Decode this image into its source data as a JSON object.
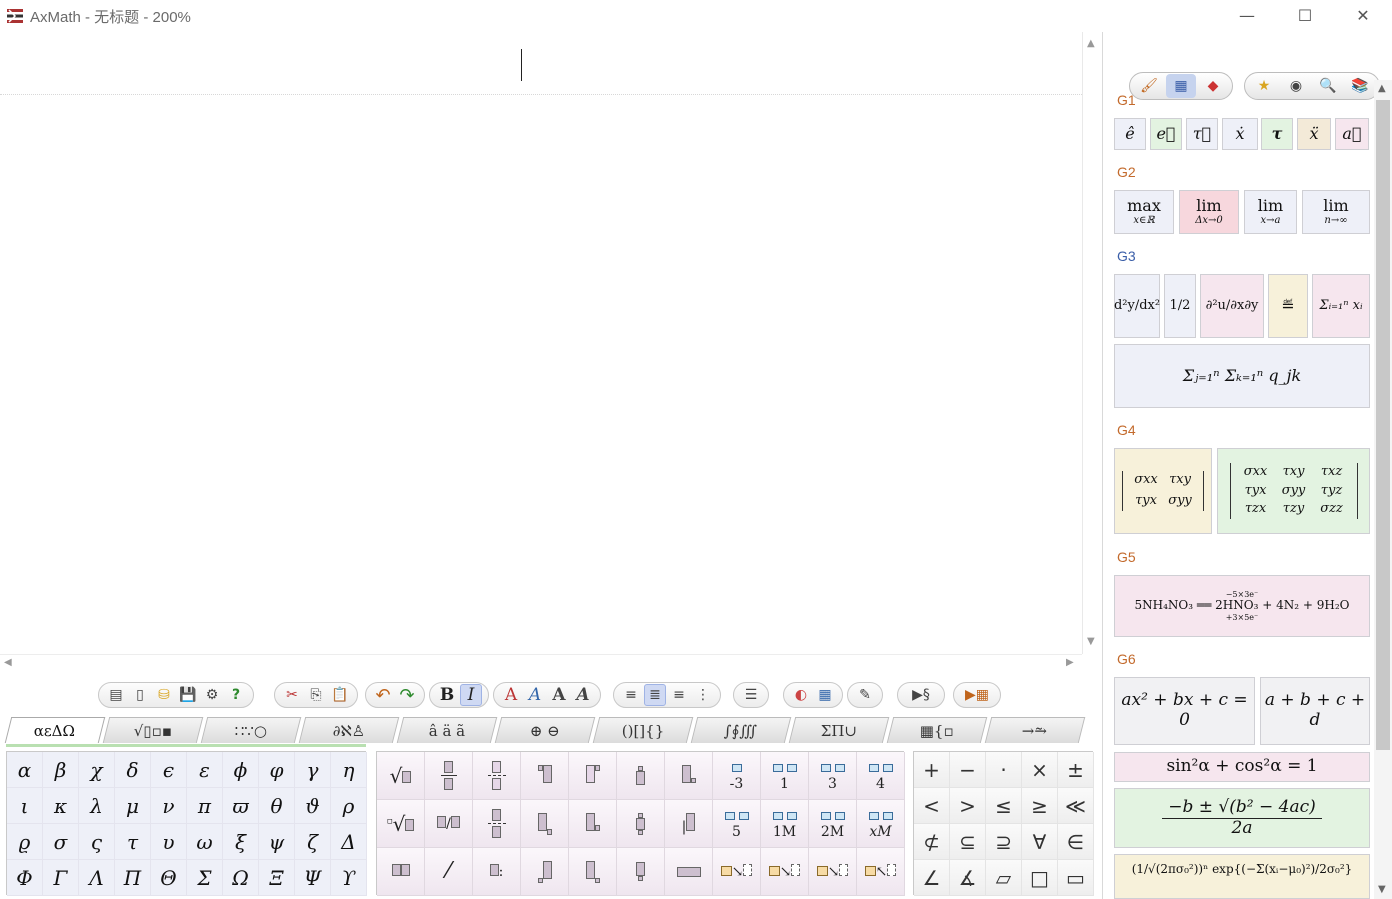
{
  "window": {
    "title": "AxMath - 无标题 - 200%",
    "minimize": "—",
    "maximize": "☐",
    "close": "✕"
  },
  "editor": {
    "scroll_up": "▲",
    "scroll_down": "▼",
    "scroll_left": "◀",
    "scroll_right": "▶"
  },
  "toolbar": {
    "groups": [
      [
        "▤",
        "▯",
        "⛁",
        "💾",
        "⚙",
        "?"
      ],
      [
        "✂",
        "⎘",
        "📋"
      ],
      [
        "↶",
        "↷"
      ],
      [
        "B",
        "I"
      ],
      [
        "A",
        "A",
        "A",
        "A"
      ],
      [
        "≡",
        "≣",
        "≡",
        "⋮"
      ],
      [
        "☰"
      ],
      [
        "◐",
        "▦"
      ],
      [
        "✎"
      ],
      [
        "▶§"
      ],
      [
        "▶▦"
      ]
    ]
  },
  "tabs": [
    "αεΔΩ",
    "√▯▫▪",
    "∷∵○",
    "∂ℵ♙",
    "â ä ã",
    "⊕ ⊖",
    "()[]{}",
    "∫∮∭",
    "ΣΠ∪",
    "▦{▫",
    "→⥲"
  ],
  "greek": [
    [
      "α",
      "β",
      "χ",
      "δ",
      "ϵ",
      "ε",
      "ϕ",
      "φ",
      "γ",
      "η"
    ],
    [
      "ι",
      "κ",
      "λ",
      "μ",
      "ν",
      "π",
      "ϖ",
      "θ",
      "ϑ",
      "ρ"
    ],
    [
      "ϱ",
      "σ",
      "ς",
      "τ",
      "υ",
      "ω",
      "ξ",
      "ψ",
      "ζ",
      "Δ"
    ],
    [
      "Φ",
      "Γ",
      "Λ",
      "Π",
      "Θ",
      "Σ",
      "Ω",
      "Ξ",
      "Ψ",
      "ϒ"
    ]
  ],
  "templates": {
    "row1_labels": [
      "√▯",
      "▯/▯",
      "⦙",
      "▪",
      "▪'",
      "▪",
      "▪·",
      "-3",
      "1",
      "3",
      "4"
    ],
    "row2_labels": [
      "√▯",
      "▯/▯",
      "⦙",
      "▪",
      "▪'",
      "▪",
      "|▪",
      "5",
      "1M",
      "2M",
      "xM"
    ],
    "row3_labels": [
      "▯▯",
      "⁄",
      "▯:",
      "▪",
      "▪.",
      "▪",
      "▭",
      "↘",
      "↘",
      "↘",
      "↖"
    ]
  },
  "operators": [
    [
      "+",
      "−",
      "·",
      "×",
      "±"
    ],
    [
      "<",
      ">",
      "≤",
      "≥",
      "≪"
    ],
    [
      "⊄",
      "⊆",
      "⊇",
      "∀",
      "∈"
    ],
    [
      "∠",
      "∡",
      "▱",
      "□",
      "▭"
    ]
  ],
  "right_toolbar": {
    "left_group": [
      "🖌",
      "▦",
      "◆"
    ],
    "right_group": [
      "★",
      "◉",
      "🔍",
      "📚"
    ]
  },
  "groups": {
    "g1": {
      "label": "G1",
      "items": [
        "ê",
        "e⃗",
        "τ⃗",
        "ẋ",
        "τ",
        "ẍ",
        "a⃗"
      ]
    },
    "g2": {
      "label": "G2",
      "items": [
        {
          "top": "max",
          "sub": "x∈ℝ"
        },
        {
          "top": "lim",
          "sub": "Δx→0"
        },
        {
          "top": "lim",
          "sub": "x→a"
        },
        {
          "top": "lim",
          "sub": "n→∞"
        }
      ]
    },
    "g3": {
      "label": "G3",
      "items": [
        "d²y/dx²",
        "1/2",
        "∂²u/∂x∂y",
        "≝",
        "Σᵢ₌₁ⁿ xᵢ"
      ],
      "double_sum": "Σⱼ₌₁ⁿ Σₖ₌₁ⁿ q_jk"
    },
    "g4": {
      "label": "G4",
      "matrix2": [
        [
          "σxx",
          "τxy"
        ],
        [
          "τyx",
          "σyy"
        ]
      ],
      "matrix3": [
        [
          "σxx",
          "τxy",
          "τxz"
        ],
        [
          "τyx",
          "σyy",
          "τyz"
        ],
        [
          "τzx",
          "τzy",
          "σzz"
        ]
      ]
    },
    "g5": {
      "label": "G5",
      "equation": "5NH₄NO₃ ══ 2HNO₃ + 4N₂ + 9H₂O",
      "top_note": "−5×3e⁻",
      "bottom_note": "+3×5e⁻"
    },
    "g6": {
      "label": "G6",
      "quadratic": "ax² + bx + c = 0",
      "braces": "a + b + c + d",
      "trig": "sin²α + cos²α = 1",
      "root": "−b ± √(b² − 4ac)",
      "root_den": "2a",
      "gauss": "(1/√(2πσ₀²))ⁿ exp{(−Σ(xᵢ−μ₀)²)/2σ₀²}"
    }
  }
}
